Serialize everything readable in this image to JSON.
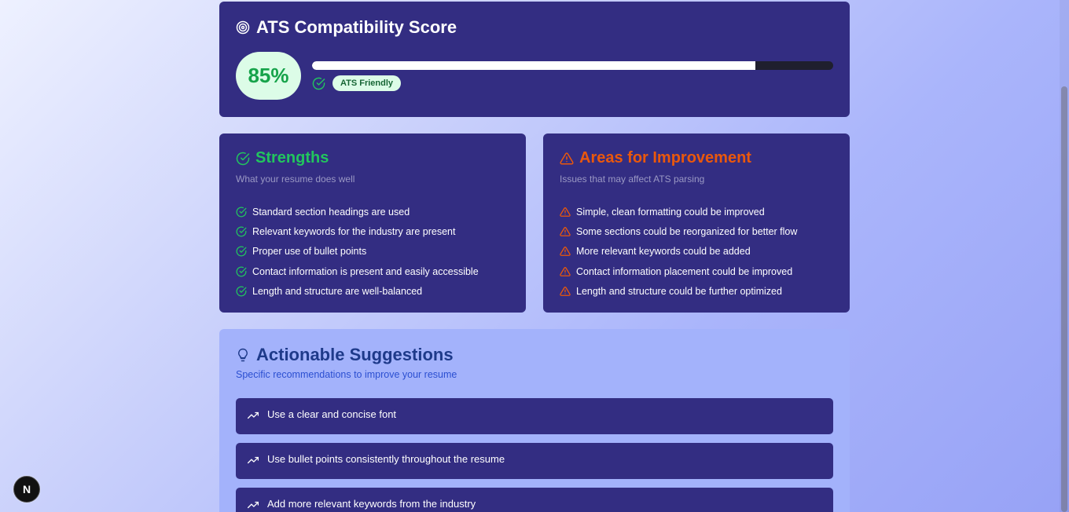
{
  "score": {
    "title": "ATS Compatibility Score",
    "value_label": "85%",
    "progress_percent": 85,
    "badge": "ATS Friendly"
  },
  "strengths": {
    "title": "Strengths",
    "subtitle": "What your resume does well",
    "color": "#22c55e",
    "items": [
      "Standard section headings are used",
      "Relevant keywords for the industry are present",
      "Proper use of bullet points",
      "Contact information is present and easily accessible",
      "Length and structure are well-balanced"
    ]
  },
  "improvements": {
    "title": "Areas for Improvement",
    "subtitle": "Issues that may affect ATS parsing",
    "color": "#ea580c",
    "items": [
      "Simple, clean formatting could be improved",
      "Some sections could be reorganized for better flow",
      "More relevant keywords could be added",
      "Contact information placement could be improved",
      "Length and structure could be further optimized"
    ]
  },
  "suggestions": {
    "title": "Actionable Suggestions",
    "subtitle": "Specific recommendations to improve your resume",
    "items": [
      "Use a clear and concise font",
      "Use bullet points consistently throughout the resume",
      "Add more relevant keywords from the industry"
    ]
  },
  "dev_badge": {
    "label": "N",
    "icon": "nextjs-logo-icon"
  },
  "icons": {
    "score": "target-icon",
    "check": "check-circle-icon",
    "warning": "warning-triangle-icon",
    "suggestion": "lightbulb-icon",
    "trend": "trending-up-icon"
  }
}
